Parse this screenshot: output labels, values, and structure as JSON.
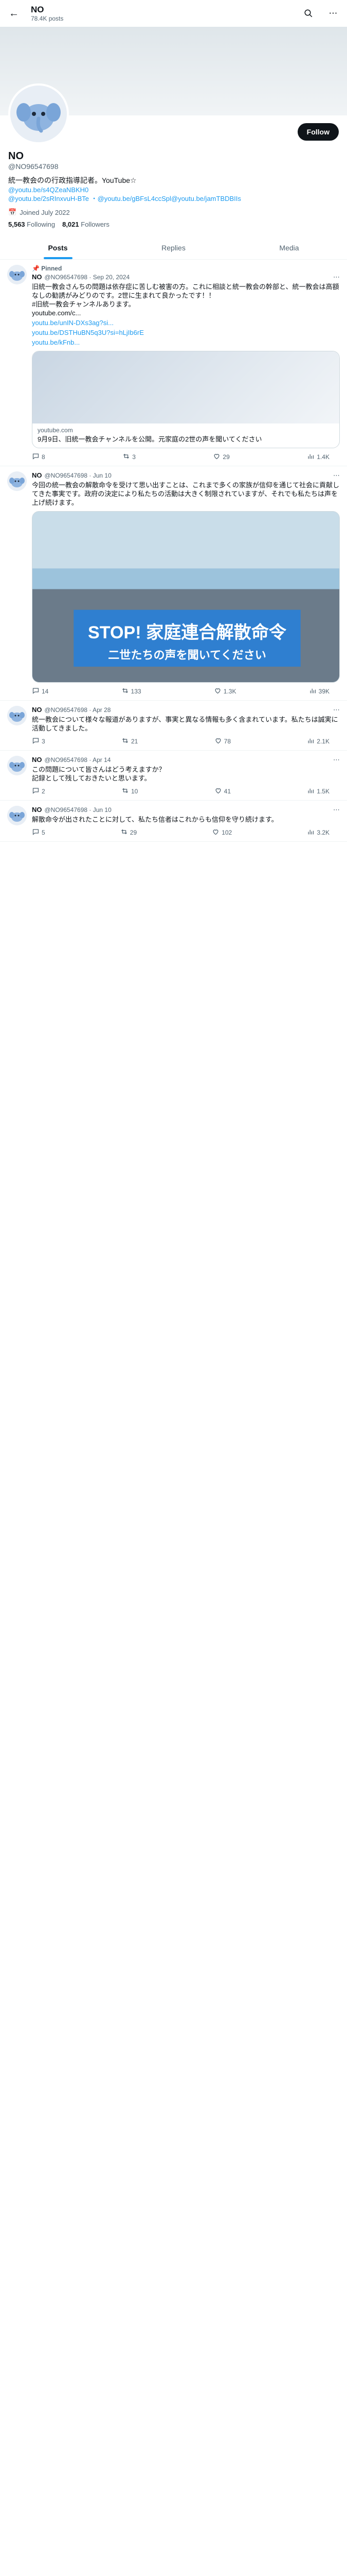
{
  "topbar": {
    "name": "NO",
    "post_count": "78.4K posts"
  },
  "profile": {
    "name": "NO",
    "handle": "@NO96547698",
    "follow_label": "Follow",
    "bio": "統一教会のの行政指導記者。YouTube☆",
    "bio_links": [
      "@youtu.be/s4QZeaNBKH0",
      "@youtu.be/2sRInxvuH-BTe ・@youtu.be/gBFsL4ccSpl@youtu.be/jamTBDBIIs"
    ],
    "joined": "Joined July 2022",
    "following_count": "5,563",
    "following_label": "Following",
    "followers_count": "8,021",
    "followers_label": "Followers"
  },
  "tabs": [
    "Posts",
    "Replies",
    "Media"
  ],
  "pinned_label": "Pinned",
  "posts": [
    {
      "meta": "@NO96547698 · Sep 20, 2024",
      "text": "旧統一教会さんちの問題は依存症に苦しむ被害の方。これに相談と統一教会の幹部と、統一教会は高額なしの勧誘がみどりのです。2世に生まれて良かったです！！\n#旧統一教会チャンネルあります。\nyoutube.com/c...",
      "links": [
        "youtu.be/unIN-DXs3ag?si...",
        "youtu.be/DSTHuBN5q3U?si=hLjIb6rE",
        "youtu.be/kFnb..."
      ],
      "card_domain": "youtube.com",
      "card_title": "9月9日、旧統一教会チャンネルを公開。元家庭の2世の声を聞いてください",
      "stats": {
        "reply": "8",
        "repost": "3",
        "like": "29",
        "view": "1.4K"
      }
    },
    {
      "meta": "@NO96547698 · Jun 10",
      "text": "今回の統一教会の解散命令を受けて思い出すことは、これまで多くの家族が信仰を通じて社会に貢献してきた事実です。政府の決定により私たちの活動は大きく制限されていますが、それでも私たちは声を上げ続けます。",
      "banner_text": "STOP! 家庭連合解散命令",
      "banner_sub": "二世たちの声を聞いてください",
      "stats": {
        "reply": "14",
        "repost": "133",
        "like": "1.3K",
        "view": "39K"
      }
    },
    {
      "meta": "@NO96547698 · Apr 28",
      "text": "統一教会について様々な報道がありますが、事実と異なる情報も多く含まれています。私たちは誠実に活動してきました。",
      "stats": {
        "reply": "3",
        "repost": "21",
        "like": "78",
        "view": "2.1K"
      }
    },
    {
      "meta": "@NO96547698 · Apr 14",
      "text": "この問題について皆さんはどう考えますか？\n記録として残しておきたいと思います。",
      "stats": {
        "reply": "2",
        "repost": "10",
        "like": "41",
        "view": "1.5K"
      }
    },
    {
      "meta": "@NO96547698 · Jun 10",
      "text": "解散命令が出されたことに対して、私たち信者はこれからも信仰を守り続けます。",
      "stats": {
        "reply": "5",
        "repost": "29",
        "like": "102",
        "view": "3.2K"
      }
    }
  ]
}
